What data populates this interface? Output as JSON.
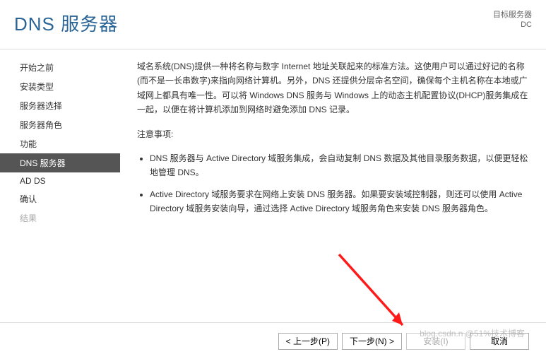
{
  "header": {
    "title": "DNS 服务器",
    "target_label": "目标服务器",
    "target_value": "DC"
  },
  "sidebar": {
    "items": [
      {
        "label": "开始之前",
        "state": "normal"
      },
      {
        "label": "安装类型",
        "state": "normal"
      },
      {
        "label": "服务器选择",
        "state": "normal"
      },
      {
        "label": "服务器角色",
        "state": "normal"
      },
      {
        "label": "功能",
        "state": "normal"
      },
      {
        "label": "DNS 服务器",
        "state": "selected"
      },
      {
        "label": "AD DS",
        "state": "normal"
      },
      {
        "label": "确认",
        "state": "normal"
      },
      {
        "label": "结果",
        "state": "disabled"
      }
    ]
  },
  "content": {
    "intro": "域名系统(DNS)提供一种将名称与数字 Internet 地址关联起来的标准方法。这使用户可以通过好记的名称(而不是一长串数字)来指向网络计算机。另外，DNS 还提供分层命名空间，确保每个主机名称在本地或广域网上都具有唯一性。可以将 Windows DNS 服务与 Windows 上的动态主机配置协议(DHCP)服务集成在一起，以便在将计算机添加到网络时避免添加 DNS 记录。",
    "notes_label": "注意事项:",
    "bullets": [
      "DNS 服务器与 Active Directory 域服务集成，会自动复制 DNS 数据及其他目录服务数据，以便更轻松地管理 DNS。",
      "Active Directory 域服务要求在网络上安装 DNS 服务器。如果要安装域控制器，则还可以使用 Active Directory 域服务安装向导，通过选择 Active Directory 域服务角色来安装 DNS 服务器角色。"
    ]
  },
  "footer": {
    "prev": "< 上一步(P)",
    "next": "下一步(N) >",
    "install": "安装(I)",
    "cancel": "取消"
  },
  "watermark": "blog.csdn.n @51%技术博客"
}
